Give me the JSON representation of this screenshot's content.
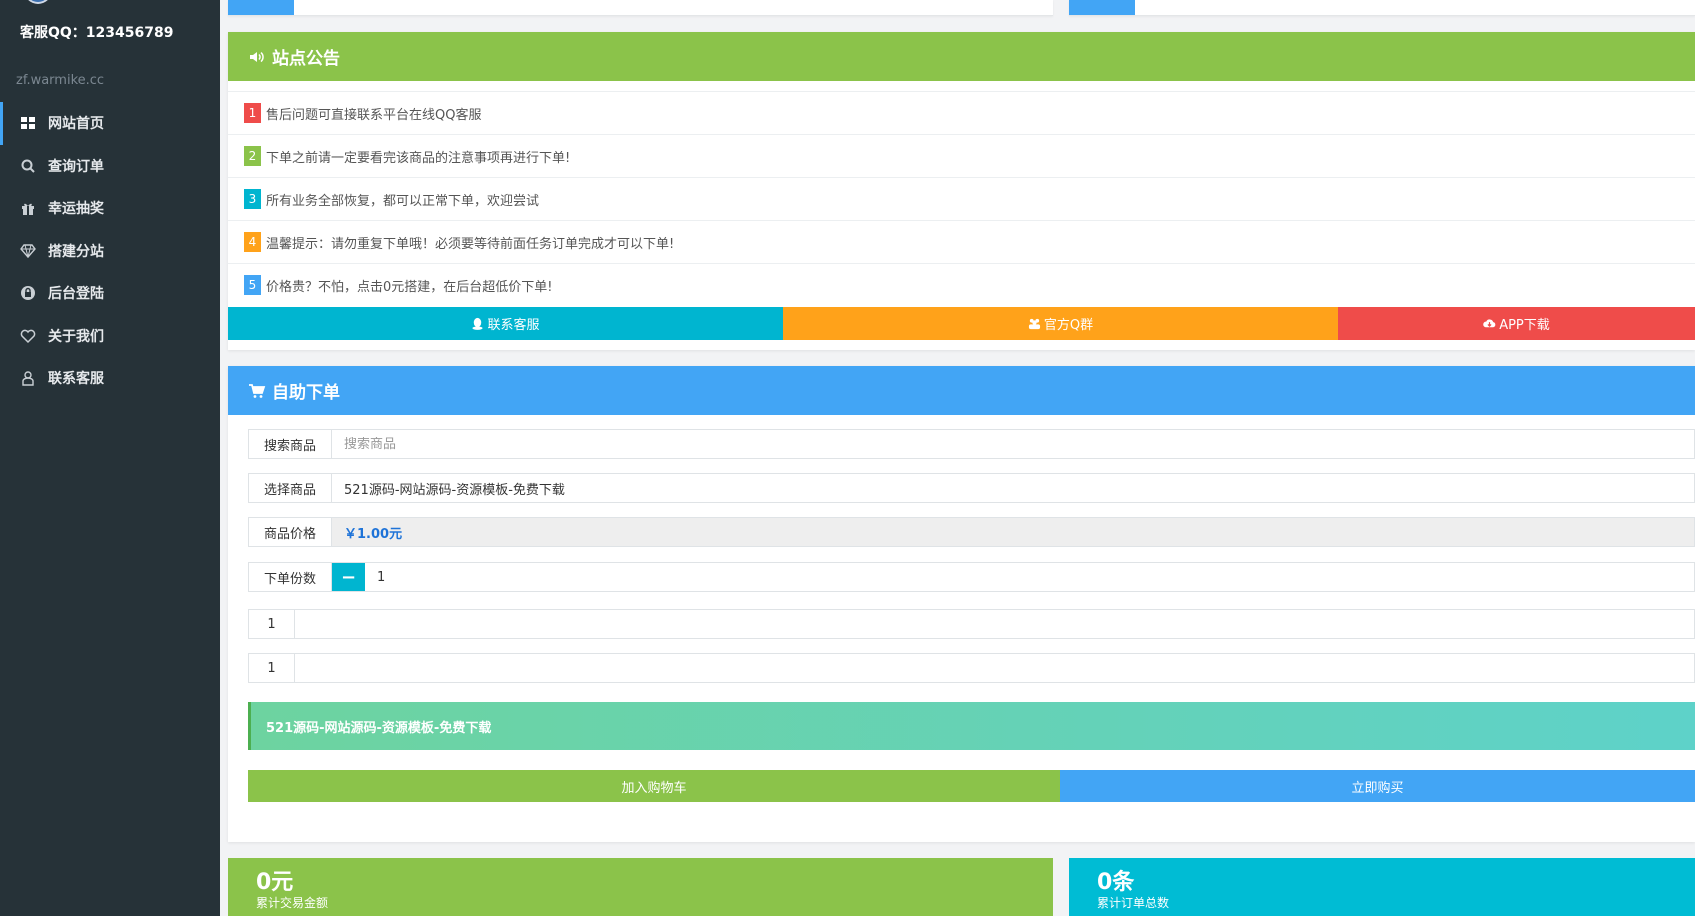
{
  "sidebar": {
    "qq_label": "客服QQ：123456789",
    "domain": "zf.warmike.cc",
    "items": [
      {
        "label": "网站首页",
        "icon": "grid-icon"
      },
      {
        "label": "查询订单",
        "icon": "search-icon"
      },
      {
        "label": "幸运抽奖",
        "icon": "gift-icon"
      },
      {
        "label": "搭建分站",
        "icon": "diamond-icon"
      },
      {
        "label": "后台登陆",
        "icon": "lock-icon"
      },
      {
        "label": "关于我们",
        "icon": "heart-icon"
      },
      {
        "label": "联系客服",
        "icon": "user-icon"
      }
    ]
  },
  "notice": {
    "title": "站点公告",
    "items": [
      {
        "num": "1",
        "color": "#ef4c4a",
        "text": "售后问题可直接联系平台在线QQ客服"
      },
      {
        "num": "2",
        "color": "#8bc34a",
        "text": "下单之前请一定要看完该商品的注意事项再进行下单!"
      },
      {
        "num": "3",
        "color": "#00b5d0",
        "text": "所有业务全部恢复，都可以正常下单，欢迎尝试"
      },
      {
        "num": "4",
        "color": "#ffa21a",
        "text": "温馨提示：请勿重复下单哦！必须要等待前面任务订单完成才可以下单!"
      },
      {
        "num": "5",
        "color": "#42a5f5",
        "text": "价格贵？不怕，点击0元搭建，在后台超低价下单!"
      }
    ],
    "btn_contact": "联系客服",
    "btn_group": "官方Q群",
    "btn_app": "APP下载"
  },
  "order": {
    "title": "自助下单",
    "search_label": "搜索商品",
    "search_placeholder": "搜索商品",
    "select_label": "选择商品",
    "select_value": "521源码-网站源码-资源模板-免费下载",
    "price_label": "商品价格",
    "price_value": "￥1.00元",
    "qty_label": "下单份数",
    "qty_minus": "−",
    "qty_value": "1",
    "input1_label": "1",
    "input2_label": "1",
    "description": "521源码-网站源码-资源模板-免费下载",
    "add_cart": "加入购物车",
    "buy_now": "立即购买"
  },
  "stats": {
    "total_amount": "0元",
    "total_amount_label": "累计交易金额",
    "total_orders": "0条",
    "total_orders_label": "累计订单总数"
  },
  "colors": {
    "green": "#8bc34a",
    "blue": "#42a5f5",
    "cyan": "#00b5d0",
    "orange": "#ffa21a",
    "red": "#ef4c4a",
    "sidebar": "#263238"
  }
}
